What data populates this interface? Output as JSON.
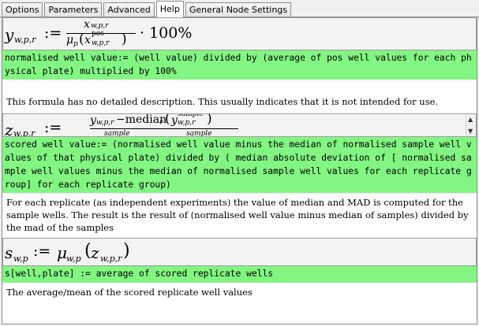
{
  "tabs": [
    "Options",
    "Parameters",
    "Advanced",
    "Help",
    "General Node Settings"
  ],
  "formula1": {
    "lhs": "y",
    "lhs_sub": "w,p,r",
    "assign": ":=",
    "num": "x",
    "num_sub": "w,p,r",
    "den_mu": "μ",
    "den_sub": "p",
    "den_x": "x",
    "den_sup": "pos",
    "den_x_sub": "w,p,r",
    "tail": "· 100%",
    "code": "normalised well value:= (well value) divided by (average of pos well values for each physical plate) multiplied by 100%",
    "desc": "This formula has no detailed description. This usually indicates that it is not intended for use."
  },
  "formula2": {
    "lhs": "z",
    "lhs_sub": "w,p,r",
    "assign": ":=",
    "num": "y",
    "num_sub": "w,p,r",
    "minus_median": "−median",
    "median_sub": "r",
    "median_arg": "y",
    "median_arg_sup": "sample",
    "median_arg_sub": "w,p,r",
    "den_partial_1": "sample",
    "den_partial_2": "sample",
    "code": "scored well value:= (normalised well value minus the median of normalised sample well values of that physical plate) divided by ( median absolute deviation of [ normalised sample well values minus the median of normalised sample well values for each replicate group] for each replicate group)",
    "desc": "For each replicate (as independent experiments) the value of median and MAD is computed for the sample wells. The result is the result of (normalised well value minus median of samples) divided by the mad of the samples"
  },
  "formula3": {
    "lhs": "s",
    "lhs_sub": "w,p",
    "assign": ":=",
    "mu": "μ",
    "mu_sub": "w,p",
    "arg": "z",
    "arg_sub": "w,p,r",
    "code": "s[well,plate] := average of scored replicate wells",
    "desc": "The average/mean of the scored replicate well values"
  },
  "scrollbar": {
    "up": "▲",
    "down": "▼"
  }
}
